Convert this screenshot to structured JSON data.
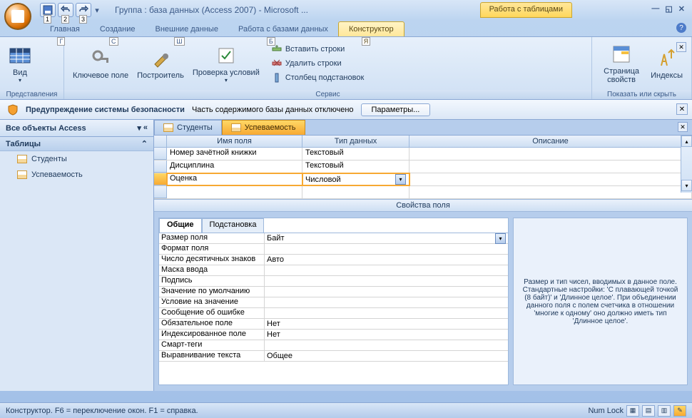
{
  "title": "Группа : база данных (Access 2007) - Microsoft ...",
  "context_tab": "Работа с таблицами",
  "qat_hints": [
    "1",
    "2",
    "3"
  ],
  "tabs": [
    {
      "label": "Главная",
      "hint": "Г"
    },
    {
      "label": "Создание",
      "hint": "С"
    },
    {
      "label": "Внешние данные",
      "hint": "Ш"
    },
    {
      "label": "Работа с базами данных",
      "hint": "Б"
    },
    {
      "label": "Конструктор",
      "hint": "Я"
    }
  ],
  "ribbon": {
    "g1": {
      "label": "Представления",
      "btn": "Вид"
    },
    "g2": {
      "label": "Сервис",
      "btns": [
        "Ключевое поле",
        "Построитель",
        "Проверка условий"
      ],
      "small": [
        "Вставить строки",
        "Удалить строки",
        "Столбец подстановок"
      ]
    },
    "g3": {
      "label": "Показать или скрыть",
      "btns": [
        "Страница свойств",
        "Индексы"
      ]
    }
  },
  "security": {
    "title": "Предупреждение системы безопасности",
    "msg": "Часть содержимого базы данных отключено",
    "btn": "Параметры..."
  },
  "nav": {
    "header": "Все объекты Access",
    "cat": "Таблицы",
    "items": [
      "Студенты",
      "Успеваемость"
    ]
  },
  "doc_tabs": [
    "Студенты",
    "Успеваемость"
  ],
  "design": {
    "cols": [
      "Имя поля",
      "Тип данных",
      "Описание"
    ],
    "rows": [
      {
        "name": "Номер зачётной книжки",
        "type": "Текстовый"
      },
      {
        "name": "Дисциплина",
        "type": "Текстовый"
      },
      {
        "name": "Оценка",
        "type": "Числовой",
        "selected": true
      }
    ]
  },
  "props_title": "Свойства поля",
  "prop_tabs": [
    "Общие",
    "Подстановка"
  ],
  "props": [
    {
      "n": "Размер поля",
      "v": "Байт",
      "dd": true
    },
    {
      "n": "Формат поля",
      "v": ""
    },
    {
      "n": "Число десятичных знаков",
      "v": "Авто"
    },
    {
      "n": "Маска ввода",
      "v": ""
    },
    {
      "n": "Подпись",
      "v": ""
    },
    {
      "n": "Значение по умолчанию",
      "v": ""
    },
    {
      "n": "Условие на значение",
      "v": ""
    },
    {
      "n": "Сообщение об ошибке",
      "v": ""
    },
    {
      "n": "Обязательное поле",
      "v": "Нет"
    },
    {
      "n": "Индексированное поле",
      "v": "Нет"
    },
    {
      "n": "Смарт-теги",
      "v": ""
    },
    {
      "n": "Выравнивание текста",
      "v": "Общее"
    }
  ],
  "help_text": "Размер и тип чисел, вводимых в данное поле.  Стандартные настройки: 'С плавающей точкой (8 байт)' и 'Длинное целое'.  При объединении данного поля с полем счетчика в отношении 'многие к одному' оно должно иметь тип 'Длинное целое'.",
  "status": {
    "left": "Конструктор.  F6 = переключение окон.  F1 = справка.",
    "numlock": "Num Lock"
  }
}
